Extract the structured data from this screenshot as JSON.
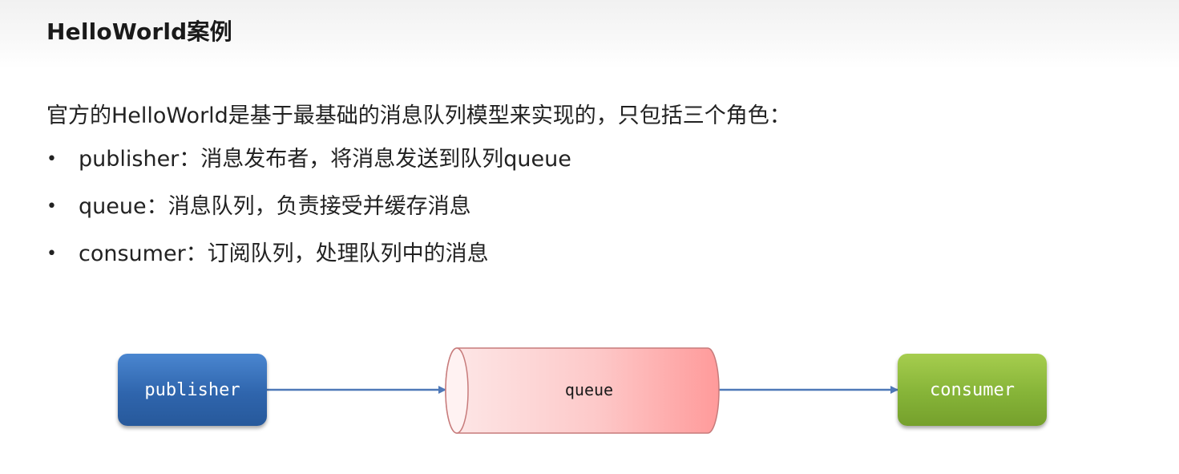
{
  "header": {
    "title": "HelloWorld案例"
  },
  "intro": "官方的HelloWorld是基于最基础的消息队列模型来实现的，只包括三个角色：",
  "bullets": [
    {
      "dot": "•",
      "text": "publisher：消息发布者，将消息发送到队列queue"
    },
    {
      "dot": "•",
      "text": "queue：消息队列，负责接受并缓存消息"
    },
    {
      "dot": "•",
      "text": "consumer：订阅队列，处理队列中的消息"
    }
  ],
  "diagram": {
    "publisher": {
      "label": "publisher",
      "color": "#2f65ad"
    },
    "queue": {
      "label": "queue",
      "color": "#ff9a9a"
    },
    "consumer": {
      "label": "consumer",
      "color": "#86b438"
    },
    "arrow_color": "#4f79b8"
  }
}
